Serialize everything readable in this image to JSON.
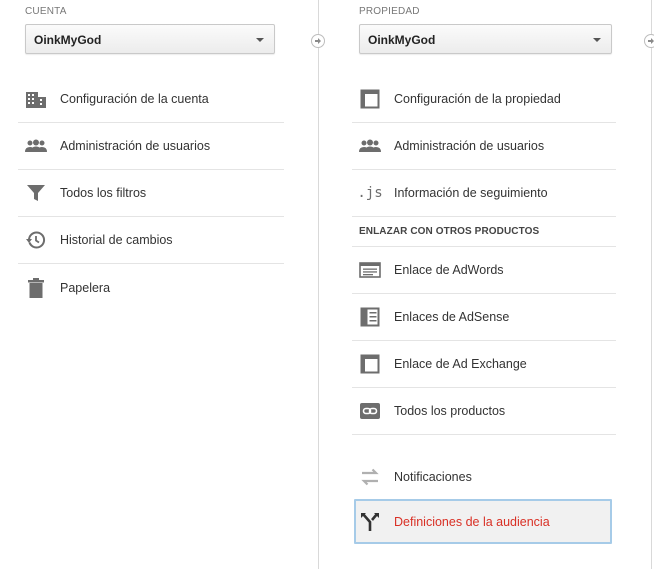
{
  "account": {
    "section_label": "CUENTA",
    "selected": "OinkMyGod",
    "items": [
      {
        "label": "Configuración de la cuenta",
        "icon": "building-icon"
      },
      {
        "label": "Administración de usuarios",
        "icon": "users-icon"
      },
      {
        "label": "Todos los filtros",
        "icon": "filter-icon"
      },
      {
        "label": "Historial de cambios",
        "icon": "history-icon"
      },
      {
        "label": "Papelera",
        "icon": "trash-icon"
      }
    ]
  },
  "property": {
    "section_label": "PROPIEDAD",
    "selected": "OinkMyGod",
    "items": [
      {
        "label": "Configuración de la propiedad",
        "icon": "window-icon"
      },
      {
        "label": "Administración de usuarios",
        "icon": "users-icon"
      },
      {
        "label": "Información de seguimiento",
        "icon": "js-icon",
        "glyph": ".js"
      }
    ],
    "link_group": {
      "header": "ENLAZAR CON OTROS PRODUCTOS",
      "items": [
        {
          "label": "Enlace de AdWords",
          "icon": "adwords-icon"
        },
        {
          "label": "Enlaces de AdSense",
          "icon": "adsense-icon"
        },
        {
          "label": "Enlace de Ad Exchange",
          "icon": "ad-exchange-icon"
        },
        {
          "label": "Todos los productos",
          "icon": "link-icon"
        }
      ]
    },
    "extra_items": [
      {
        "label": "Notificaciones",
        "icon": "swap-arrows-icon"
      },
      {
        "label": "Definiciones de la audiencia",
        "icon": "audience-fork-icon",
        "selected": true
      }
    ]
  },
  "colors": {
    "selected_text": "#d93025",
    "selected_border": "#a6cbe8",
    "icon_gray": "#6d6d6d"
  }
}
